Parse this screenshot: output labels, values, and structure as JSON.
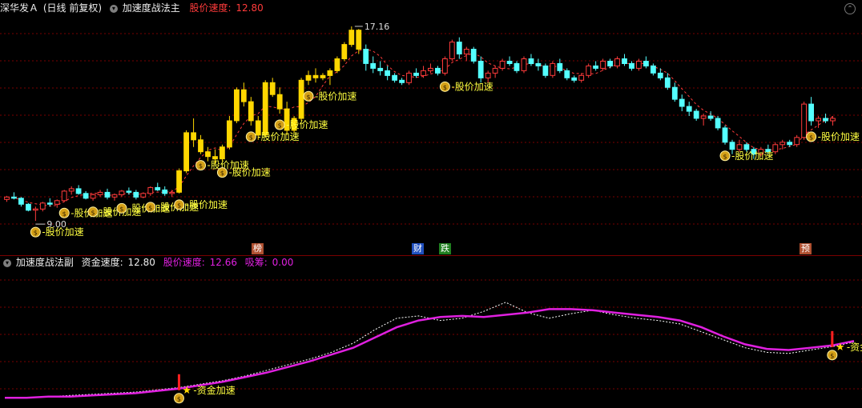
{
  "top_header": {
    "stock": "深华发Ａ",
    "period": "(日线 前复权)",
    "indicator": "加速度战法主",
    "metric_label": "股价速度:",
    "metric_value": "12.80"
  },
  "sub_header": {
    "indicator": "加速度战法副",
    "fund_label": "资金速度:",
    "fund_value": "12.80",
    "price_label": "股价速度:",
    "price_value": "12.66",
    "chip_label": "吸筹:",
    "chip_value": "0.00"
  },
  "colors": {
    "up": "#ff3b3b",
    "down": "#54ffff",
    "accel": "#ffd700",
    "grid": "#7a0000",
    "sub_line": "#e020e0",
    "sub_dash": "#ffffff"
  },
  "main_chart": {
    "high_label": "17.16",
    "low_label": "9.00",
    "signal_label": "股价加速",
    "events": [
      "榜",
      "财",
      "跌",
      "预"
    ]
  },
  "sub_chart": {
    "signal_label": "资金加速"
  },
  "chart_data": {
    "type": "candlestick",
    "price_high": 17.16,
    "price_low": 9.0,
    "candles": [
      [
        9.9,
        10.05,
        9.8,
        10.0
      ],
      [
        10.0,
        10.2,
        9.9,
        9.95
      ],
      [
        9.95,
        10.0,
        9.6,
        9.7
      ],
      [
        9.7,
        9.75,
        9.4,
        9.45
      ],
      [
        9.45,
        9.6,
        9.0,
        9.5
      ],
      [
        9.5,
        9.8,
        9.4,
        9.75
      ],
      [
        9.75,
        9.95,
        9.6,
        9.7
      ],
      [
        9.7,
        9.9,
        9.55,
        9.85
      ],
      [
        9.85,
        10.3,
        9.8,
        10.25
      ],
      [
        10.25,
        10.45,
        10.1,
        10.35
      ],
      [
        10.35,
        10.5,
        10.1,
        10.15
      ],
      [
        10.15,
        10.25,
        9.9,
        9.95
      ],
      [
        9.95,
        10.15,
        9.85,
        10.1
      ],
      [
        10.1,
        10.3,
        10.0,
        10.2
      ],
      [
        10.2,
        10.35,
        9.9,
        10.0
      ],
      [
        10.0,
        10.15,
        9.85,
        10.1
      ],
      [
        10.1,
        10.3,
        10.0,
        10.25
      ],
      [
        10.25,
        10.4,
        10.1,
        10.2
      ],
      [
        10.2,
        10.3,
        9.9,
        10.0
      ],
      [
        10.0,
        10.2,
        9.95,
        10.15
      ],
      [
        10.15,
        10.45,
        10.05,
        10.4
      ],
      [
        10.4,
        10.6,
        10.25,
        10.3
      ],
      [
        10.3,
        10.45,
        10.05,
        10.15
      ],
      [
        10.15,
        10.3,
        10.0,
        10.2
      ],
      [
        10.2,
        11.2,
        10.15,
        11.1
      ],
      [
        11.1,
        12.8,
        11.0,
        12.7
      ],
      [
        12.7,
        13.3,
        12.1,
        12.4
      ],
      [
        12.4,
        12.6,
        11.8,
        11.9
      ],
      [
        11.9,
        12.1,
        11.5,
        11.7
      ],
      [
        11.7,
        12.0,
        11.4,
        11.6
      ],
      [
        11.6,
        12.2,
        11.5,
        12.1
      ],
      [
        12.1,
        13.4,
        12.0,
        13.2
      ],
      [
        13.2,
        14.6,
        13.1,
        14.5
      ],
      [
        14.5,
        14.8,
        13.8,
        14.0
      ],
      [
        14.0,
        14.2,
        13.0,
        13.2
      ],
      [
        13.2,
        13.4,
        12.4,
        12.6
      ],
      [
        12.6,
        14.9,
        12.5,
        14.8
      ],
      [
        14.8,
        15.0,
        14.2,
        14.3
      ],
      [
        14.3,
        14.6,
        13.5,
        13.7
      ],
      [
        13.7,
        14.0,
        12.6,
        12.8
      ],
      [
        12.8,
        13.4,
        12.7,
        13.3
      ],
      [
        13.3,
        15.0,
        13.2,
        14.9
      ],
      [
        14.9,
        15.3,
        14.7,
        15.1
      ],
      [
        15.1,
        15.4,
        14.8,
        15.0
      ],
      [
        15.0,
        15.2,
        14.9,
        15.1
      ],
      [
        15.1,
        15.4,
        14.7,
        15.3
      ],
      [
        15.3,
        15.9,
        15.2,
        15.8
      ],
      [
        15.8,
        16.5,
        15.7,
        16.4
      ],
      [
        16.4,
        17.16,
        16.3,
        17.0
      ],
      [
        17.0,
        17.05,
        16.0,
        16.2
      ],
      [
        16.2,
        16.4,
        15.3,
        15.6
      ],
      [
        15.6,
        15.9,
        15.2,
        15.4
      ],
      [
        15.4,
        15.7,
        15.1,
        15.3
      ],
      [
        15.3,
        15.5,
        14.9,
        15.1
      ],
      [
        15.1,
        15.2,
        14.8,
        14.9
      ],
      [
        14.9,
        15.0,
        14.7,
        14.8
      ],
      [
        14.8,
        15.3,
        14.7,
        15.2
      ],
      [
        15.2,
        15.4,
        15.0,
        15.1
      ],
      [
        15.1,
        15.5,
        15.0,
        15.3
      ],
      [
        15.3,
        15.6,
        15.2,
        15.4
      ],
      [
        15.4,
        15.5,
        15.1,
        15.2
      ],
      [
        15.2,
        15.9,
        15.1,
        15.8
      ],
      [
        15.8,
        16.6,
        15.7,
        16.5
      ],
      [
        16.5,
        16.7,
        15.8,
        16.0
      ],
      [
        16.0,
        16.3,
        15.7,
        16.2
      ],
      [
        16.2,
        16.3,
        15.6,
        15.7
      ],
      [
        15.7,
        15.9,
        14.8,
        15.0
      ],
      [
        15.0,
        15.3,
        14.8,
        15.2
      ],
      [
        15.2,
        15.5,
        15.0,
        15.4
      ],
      [
        15.4,
        15.8,
        15.3,
        15.7
      ],
      [
        15.7,
        15.9,
        15.5,
        15.6
      ],
      [
        15.6,
        15.7,
        15.2,
        15.3
      ],
      [
        15.3,
        15.9,
        15.2,
        15.8
      ],
      [
        15.8,
        16.0,
        15.5,
        15.6
      ],
      [
        15.6,
        15.8,
        15.3,
        15.5
      ],
      [
        15.5,
        15.6,
        15.0,
        15.1
      ],
      [
        15.1,
        15.7,
        15.0,
        15.6
      ],
      [
        15.6,
        15.8,
        15.2,
        15.3
      ],
      [
        15.3,
        15.4,
        14.9,
        15.0
      ],
      [
        15.0,
        15.1,
        14.8,
        14.9
      ],
      [
        14.9,
        15.2,
        14.8,
        15.1
      ],
      [
        15.1,
        15.6,
        15.0,
        15.5
      ],
      [
        15.5,
        15.7,
        15.3,
        15.4
      ],
      [
        15.4,
        15.8,
        15.3,
        15.7
      ],
      [
        15.7,
        15.8,
        15.4,
        15.5
      ],
      [
        15.5,
        15.9,
        15.4,
        15.8
      ],
      [
        15.8,
        16.0,
        15.5,
        15.6
      ],
      [
        15.6,
        15.7,
        15.3,
        15.4
      ],
      [
        15.4,
        15.8,
        15.3,
        15.7
      ],
      [
        15.7,
        15.9,
        15.4,
        15.5
      ],
      [
        15.5,
        15.6,
        15.1,
        15.2
      ],
      [
        15.2,
        15.4,
        14.9,
        15.0
      ],
      [
        15.0,
        15.2,
        14.5,
        14.6
      ],
      [
        14.6,
        14.8,
        14.0,
        14.1
      ],
      [
        14.1,
        14.3,
        13.6,
        13.8
      ],
      [
        13.8,
        14.0,
        13.4,
        13.6
      ],
      [
        13.6,
        13.7,
        13.2,
        13.3
      ],
      [
        13.3,
        13.5,
        13.0,
        13.4
      ],
      [
        13.4,
        13.6,
        13.2,
        13.3
      ],
      [
        13.3,
        13.4,
        12.8,
        12.9
      ],
      [
        12.9,
        13.0,
        12.2,
        12.3
      ],
      [
        12.3,
        12.4,
        11.8,
        12.0
      ],
      [
        12.0,
        12.4,
        11.9,
        12.2
      ],
      [
        12.2,
        12.3,
        11.9,
        12.0
      ],
      [
        12.0,
        12.1,
        11.6,
        11.8
      ],
      [
        11.8,
        12.1,
        11.7,
        12.0
      ],
      [
        12.0,
        12.2,
        11.8,
        11.9
      ],
      [
        11.9,
        12.3,
        11.8,
        12.2
      ],
      [
        12.2,
        12.4,
        12.0,
        12.3
      ],
      [
        12.3,
        12.4,
        12.1,
        12.2
      ],
      [
        12.2,
        12.6,
        12.1,
        12.5
      ],
      [
        12.5,
        14.0,
        12.4,
        13.9
      ],
      [
        13.9,
        14.2,
        13.0,
        13.2
      ],
      [
        13.2,
        13.4,
        12.9,
        13.3
      ],
      [
        13.3,
        13.5,
        13.1,
        13.2
      ],
      [
        13.2,
        13.4,
        13.0,
        13.3
      ]
    ],
    "accel_candles": [
      24,
      25,
      26,
      27,
      28,
      29,
      30,
      31,
      32,
      33,
      34,
      35,
      36,
      37,
      38,
      39,
      40,
      41,
      42,
      43,
      44,
      45,
      46,
      47,
      48,
      49
    ],
    "main_signals": [
      4,
      8,
      12,
      16,
      20,
      24,
      27,
      30,
      34,
      38,
      42,
      61,
      100,
      112
    ],
    "sub_series": {
      "solid": [
        0.02,
        0.02,
        0.03,
        0.03,
        0.04,
        0.05,
        0.06,
        0.08,
        0.1,
        0.13,
        0.16,
        0.2,
        0.24,
        0.29,
        0.34,
        0.4,
        0.46,
        0.55,
        0.64,
        0.7,
        0.73,
        0.74,
        0.73,
        0.75,
        0.77,
        0.8,
        0.8,
        0.79,
        0.77,
        0.75,
        0.73,
        0.7,
        0.64,
        0.56,
        0.49,
        0.45,
        0.44,
        0.46,
        0.48,
        0.52
      ],
      "dashed": [
        0.02,
        0.02,
        0.03,
        0.04,
        0.05,
        0.06,
        0.07,
        0.09,
        0.11,
        0.14,
        0.17,
        0.21,
        0.26,
        0.31,
        0.36,
        0.42,
        0.5,
        0.62,
        0.72,
        0.74,
        0.7,
        0.72,
        0.78,
        0.86,
        0.77,
        0.72,
        0.76,
        0.79,
        0.75,
        0.72,
        0.7,
        0.67,
        0.6,
        0.53,
        0.46,
        0.42,
        0.41,
        0.44,
        0.47,
        0.51
      ]
    },
    "sub_signals": [
      8,
      38
    ]
  }
}
